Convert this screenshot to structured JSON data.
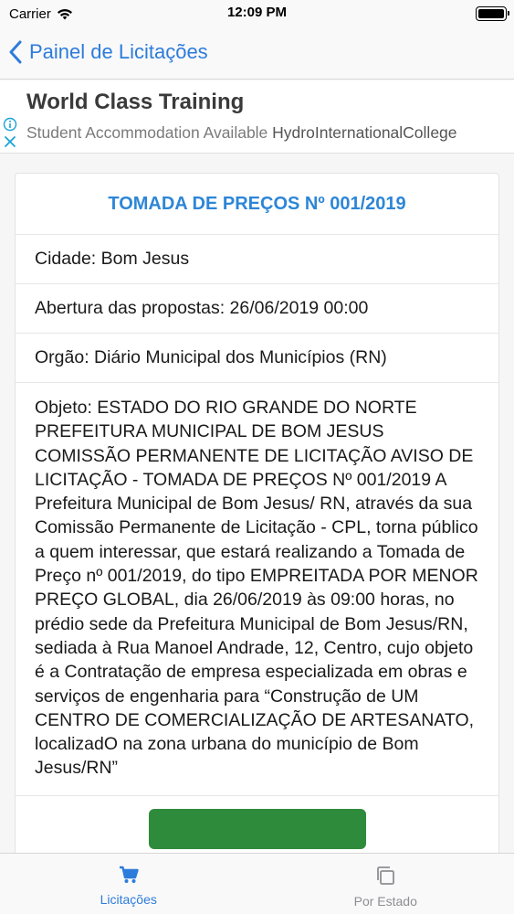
{
  "status_bar": {
    "carrier": "Carrier",
    "time": "12:09 PM"
  },
  "nav": {
    "back_label": "Painel de Licitações",
    "accent_color": "#2d7cdb"
  },
  "ad": {
    "title": "World Class Training",
    "subtitle": "Student Accommodation Available",
    "advertiser": "HydroInternationalCollege",
    "info_icon": "info-icon",
    "close_icon": "close-icon"
  },
  "card": {
    "title": "TOMADA DE PREÇOS Nº 001/2019",
    "title_color": "#2d86d6",
    "city": "Cidade: Bom Jesus",
    "opening": "Abertura das propostas: 26/06/2019 00:00",
    "organ": "Orgão: Diário Municipal dos Municípios (RN)",
    "object": "Objeto: ESTADO DO RIO GRANDE DO NORTE PREFEITURA MUNICIPAL DE BOM JESUS COMISSÃO PERMANENTE DE LICITAÇÃO AVISO DE LICITAÇÃO - TOMADA DE PREÇOS Nº 001/2019 A Prefeitura Municipal de Bom Jesus/ RN, através da sua Comissão Permanente de Licitação - CPL, torna público a quem interessar, que estará realizando a Tomada de Preço nº 001/2019, do tipo EMPREITADA POR MENOR PREÇO GLOBAL, dia 26/06/2019 às 09:00 horas, no prédio sede da Prefeitura Municipal de Bom Jesus/RN, sediada à Rua Manoel Andrade, 12, Centro, cujo objeto é a Contratação de empresa especializada em obras e serviços de engenharia para “Construção de UM CENTRO DE COMERCIALIZAÇÃO DE ARTESANATO, localizadO na zona urbana do município de Bom Jesus/RN”",
    "action_button_color": "#2e8b3c"
  },
  "tabs": [
    {
      "label": "Licitações",
      "icon": "cart-icon",
      "active": true
    },
    {
      "label": "Por Estado",
      "icon": "copy-icon",
      "active": false
    }
  ]
}
